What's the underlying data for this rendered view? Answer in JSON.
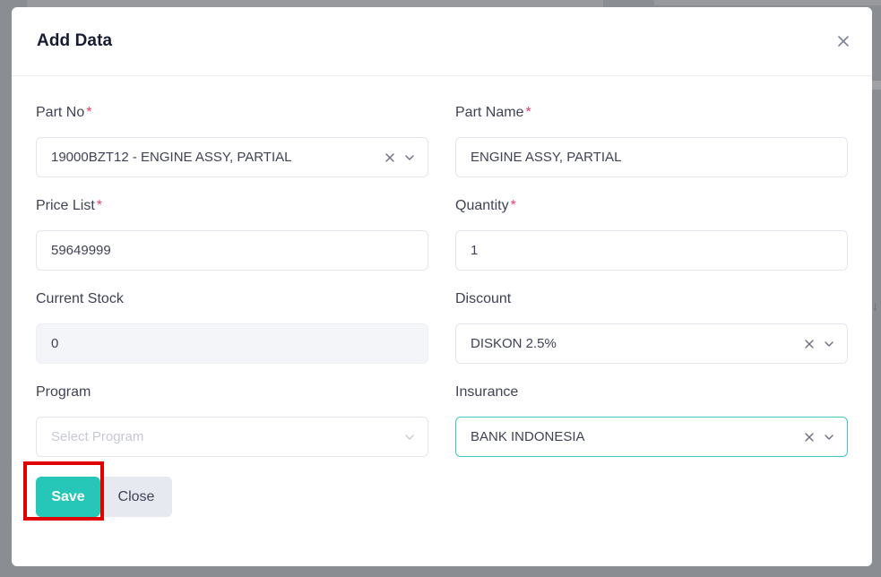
{
  "modal": {
    "title": "Add Data",
    "close_icon": "close-icon"
  },
  "fields": {
    "part_no": {
      "label": "Part No",
      "required_mark": "*",
      "value": "19000BZT12 - ENGINE ASSY, PARTIAL"
    },
    "part_name": {
      "label": "Part Name",
      "required_mark": "*",
      "value": "ENGINE ASSY, PARTIAL"
    },
    "price_list": {
      "label": "Price List",
      "required_mark": "*",
      "value": "59649999"
    },
    "quantity": {
      "label": "Quantity",
      "required_mark": "*",
      "value": "1"
    },
    "current_stock": {
      "label": "Current Stock",
      "value": "0"
    },
    "discount": {
      "label": "Discount",
      "value": "DISKON 2.5%"
    },
    "program": {
      "label": "Program",
      "placeholder": "Select Program"
    },
    "insurance": {
      "label": "Insurance",
      "value": "BANK INDONESIA"
    }
  },
  "buttons": {
    "save": "Save",
    "close": "Close"
  },
  "colors": {
    "primary": "#26c6b9",
    "required": "#f1416c",
    "highlight": "#e00000"
  }
}
